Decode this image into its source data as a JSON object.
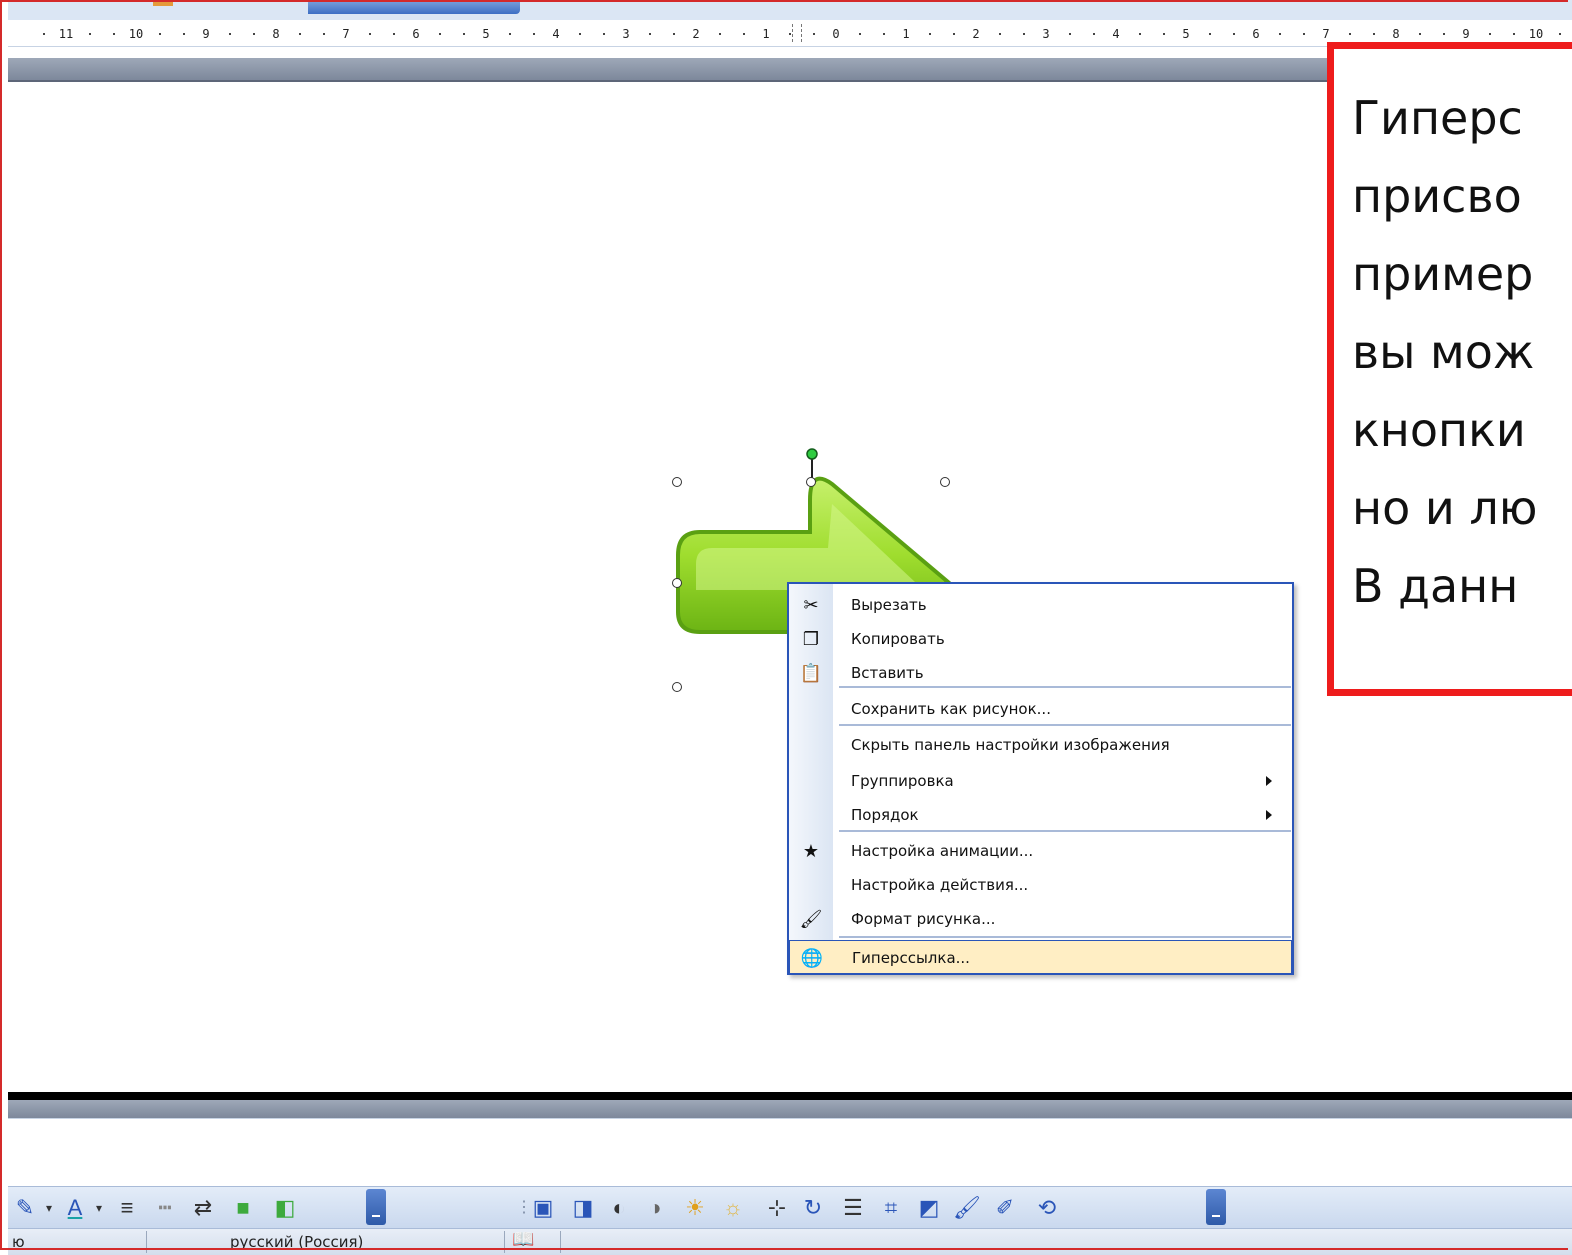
{
  "ruler": {
    "ticks": [
      "11",
      "10",
      "9",
      "8",
      "7",
      "6",
      "5",
      "4",
      "3",
      "2",
      "1",
      "0",
      "1",
      "2",
      "3",
      "4",
      "5",
      "6",
      "7",
      "8",
      "9",
      "10"
    ]
  },
  "callout": {
    "lines": [
      "Гиперс",
      "присво",
      "пример",
      "вы мож",
      "кнопки",
      "но и лю",
      "В данн"
    ]
  },
  "context_menu": {
    "items": [
      {
        "label": "Вырезать",
        "icon": "scissors-icon",
        "glyph": "✂"
      },
      {
        "label": "Копировать",
        "icon": "copy-icon",
        "glyph": "❐"
      },
      {
        "label": "Вставить",
        "icon": "paste-icon",
        "glyph": "📋"
      },
      {
        "label": "Сохранить как рисунок...",
        "icon": "",
        "glyph": ""
      },
      {
        "label": "Скрыть панель настройки изображения",
        "icon": "",
        "glyph": ""
      },
      {
        "label": "Группировка",
        "icon": "",
        "glyph": "",
        "submenu": true
      },
      {
        "label": "Порядок",
        "icon": "",
        "glyph": "",
        "submenu": true
      },
      {
        "label": "Настройка анимации...",
        "icon": "animation-star-icon",
        "glyph": "★"
      },
      {
        "label": "Настройка действия...",
        "icon": "",
        "glyph": ""
      },
      {
        "label": "Формат рисунка...",
        "icon": "format-picture-icon",
        "glyph": "🖌"
      },
      {
        "label": "Гиперссылка...",
        "icon": "hyperlink-globe-icon",
        "glyph": "🌐",
        "highlighted": true
      }
    ]
  },
  "statusbar": {
    "left_fragment": "ю",
    "language": "русский (Россия)"
  },
  "colors": {
    "frame_border": "#d42a2a",
    "callout_border": "#ee1c1c",
    "menu_border": "#2a55b8",
    "menu_highlight": "#ffeec4",
    "shape_fill": "#8ed11e"
  }
}
